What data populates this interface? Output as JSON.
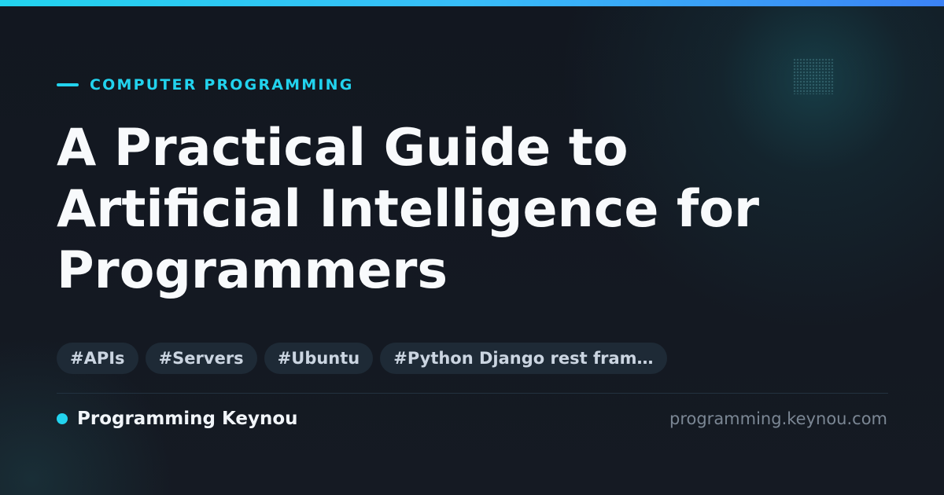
{
  "header": {
    "category": "COMPUTER PROGRAMMING"
  },
  "article": {
    "title": "A Practical Guide to Artificial Intelligence for Programmers"
  },
  "tags": [
    "#APIs",
    "#Servers",
    "#Ubuntu",
    "#Python Django rest fram…"
  ],
  "footer": {
    "brand_name": "Programming Keynou",
    "site_url": "programming.keynou.com"
  },
  "colors": {
    "accent": "#22d3ee",
    "background": "#141821",
    "title_text": "#f8fafc",
    "tag_background": "#1e2a36",
    "tag_text": "#cbd5e1",
    "muted_text": "#7b8794"
  }
}
